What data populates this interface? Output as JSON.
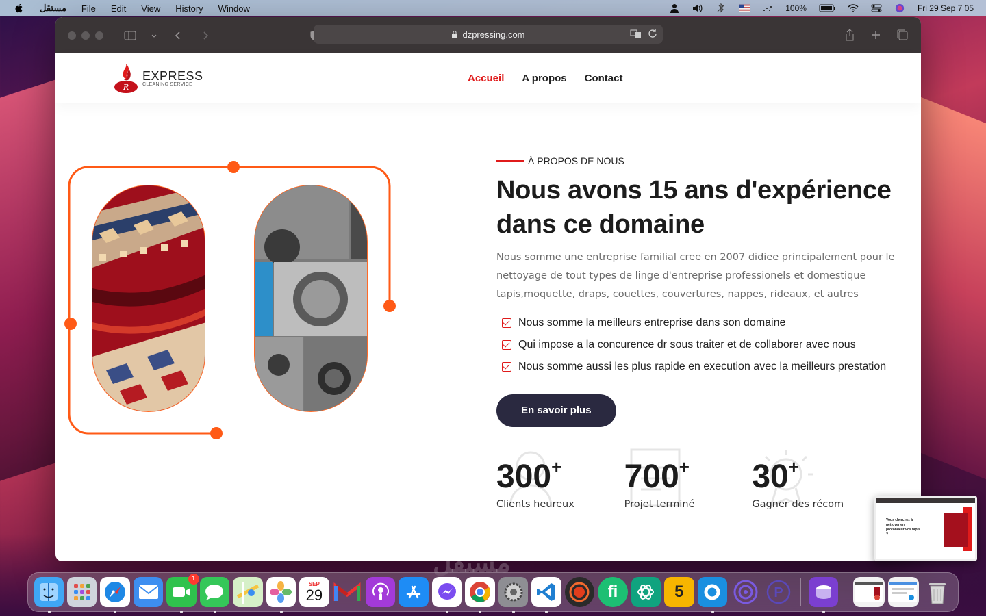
{
  "menubar": {
    "app_name": "مستقل",
    "menus": [
      "File",
      "Edit",
      "View",
      "History",
      "Window"
    ],
    "battery": "100%",
    "datetime": "Fri 29 Sep  7 05"
  },
  "browser": {
    "url": "dzpressing.com"
  },
  "site": {
    "logo": {
      "title": "EXPRESS",
      "subtitle": "CLEANING SERVICE"
    },
    "nav": [
      {
        "label": "Accueil",
        "active": true
      },
      {
        "label": "A propos",
        "active": false
      },
      {
        "label": "Contact",
        "active": false
      }
    ],
    "about": {
      "eyebrow": "À PROPOS DE NOUS",
      "headline": "Nous avons 15 ans d'expérience dans ce domaine",
      "description": "Nous somme une entreprise familial cree en 2007 didiee principalement pour le nettoyage de tout types de linge d'entreprise professionels et domestique tapis,moquette, draps, couettes, couvertures, nappes, rideaux, et autres",
      "checklist": [
        "Nous somme la meilleurs entreprise dans son domaine",
        "Qui impose a la concurence dr sous traiter et de collaborer avec nous",
        "Nous somme aussi les plus rapide en execution avec la meilleurs prestation"
      ],
      "cta": "En savoir plus"
    },
    "stats": [
      {
        "number": "300",
        "suffix": "+",
        "label": "Clients heureux"
      },
      {
        "number": "700",
        "suffix": "+",
        "label": "Projet terminé"
      },
      {
        "number": "30",
        "suffix": "+",
        "label": "Gagner des récom"
      }
    ]
  },
  "thumbnail": {
    "text": "Vous cherchez à nettoyer en profondeur vos tapis ?"
  },
  "dock": {
    "calendar_month": "SEP",
    "calendar_day": "29",
    "facetime_badge": "1",
    "watermark": "مستقل",
    "apps": [
      {
        "name": "finder-app",
        "color": "#3fa7f5"
      },
      {
        "name": "launchpad-app",
        "color": "#cfd4dc"
      },
      {
        "name": "safari-app",
        "color": "#1e88e5"
      },
      {
        "name": "mail-app",
        "color": "#3d8ef0"
      },
      {
        "name": "facetime-app",
        "color": "#2fc24d"
      },
      {
        "name": "messages-app",
        "color": "#35c759"
      },
      {
        "name": "maps-app",
        "color": "#5cc16a"
      },
      {
        "name": "photos-app",
        "color": "#f5f5f5"
      },
      {
        "name": "calendar-app",
        "color": "#ffffff"
      },
      {
        "name": "gmail-app",
        "color": "#ffffff"
      },
      {
        "name": "podcasts-app",
        "color": "#a33ad9"
      },
      {
        "name": "app-store-app",
        "color": "#1e8cf5"
      },
      {
        "name": "messenger-app",
        "color": "#ffffff"
      },
      {
        "name": "chrome-app",
        "color": "#ffffff"
      },
      {
        "name": "system-settings-app",
        "color": "#8e8e93"
      },
      {
        "name": "vscode-app",
        "color": "#ffffff"
      },
      {
        "name": "recorder-app",
        "color": "#2a2a2a"
      },
      {
        "name": "fiverr-app",
        "color": "#1dbf73"
      },
      {
        "name": "chatgpt-app",
        "color": "#10a37f"
      },
      {
        "name": "app-5",
        "color": "#f7b500"
      },
      {
        "name": "app-o",
        "color": "#1a8fe0"
      },
      {
        "name": "podcast-alt-app",
        "color": "#6a4fd9"
      },
      {
        "name": "app-p",
        "color": "#4b3aa8"
      },
      {
        "name": "disk-app",
        "color": "#7b3fd0"
      }
    ]
  }
}
